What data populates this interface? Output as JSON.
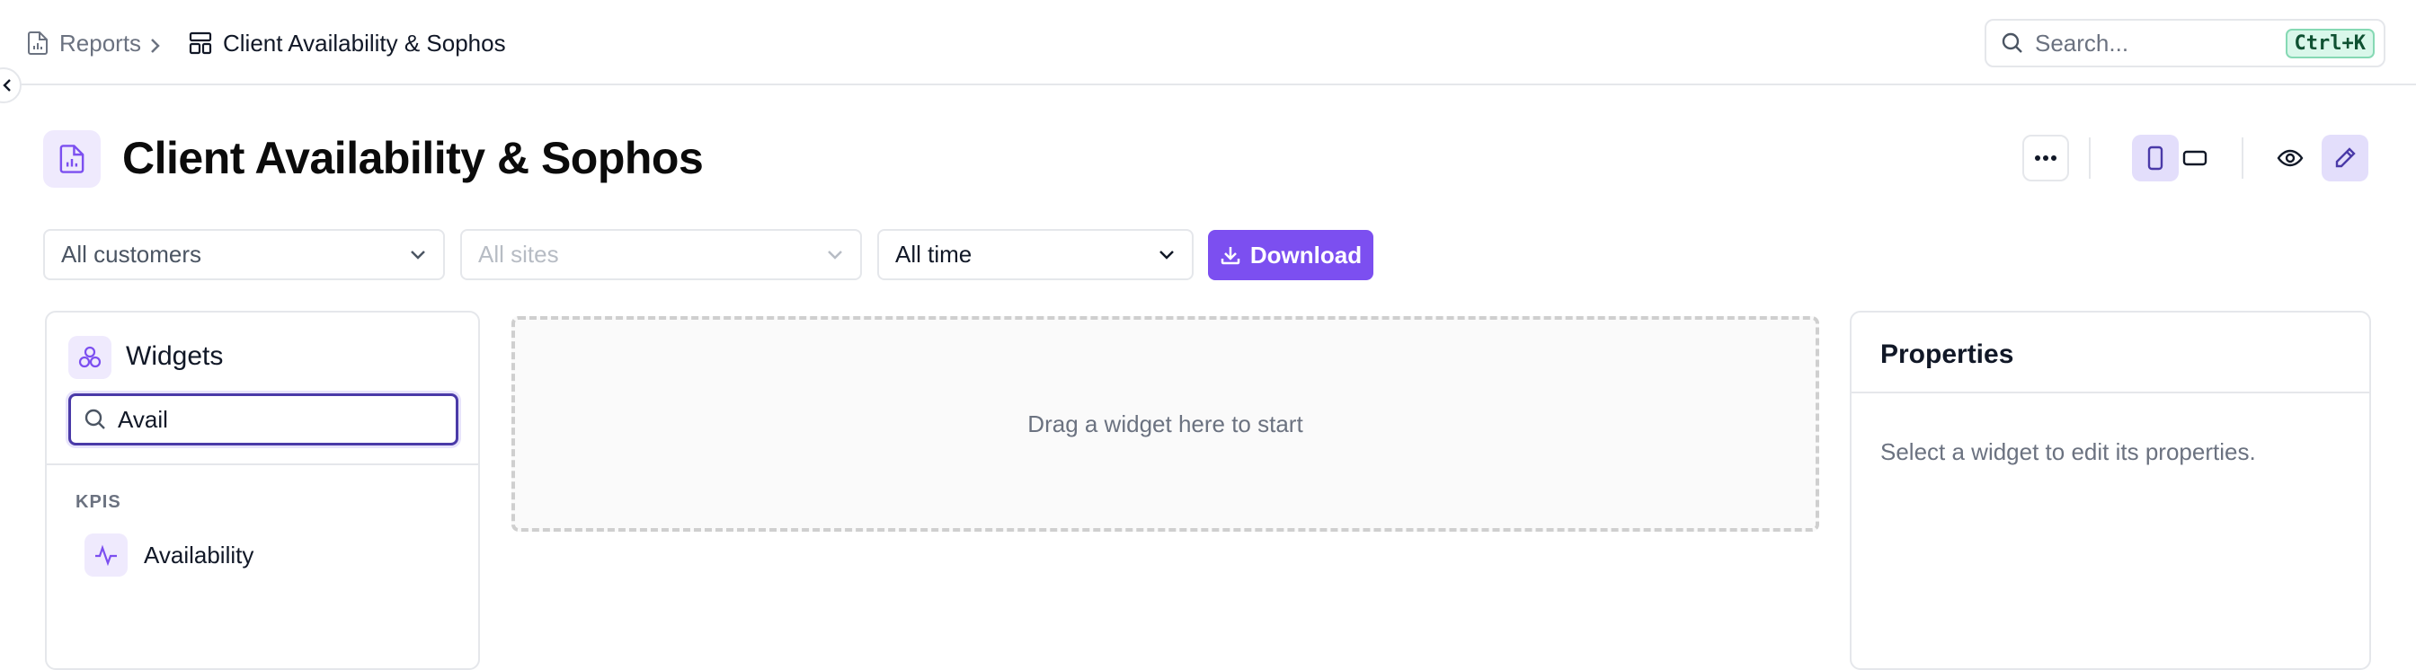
{
  "breadcrumb": {
    "parent": "Reports",
    "current": "Client Availability & Sophos"
  },
  "search": {
    "placeholder": "Search...",
    "shortcut": "Ctrl+K"
  },
  "page": {
    "title": "Client Availability & Sophos"
  },
  "filters": {
    "customers": "All customers",
    "sites": "All sites",
    "time": "All time",
    "download_label": "Download"
  },
  "widgets_panel": {
    "title": "Widgets",
    "search_value": "Avail",
    "section_label": "KPIS",
    "items": [
      {
        "label": "Availability",
        "icon": "activity-icon"
      }
    ]
  },
  "canvas": {
    "empty_text": "Drag a widget here to start"
  },
  "properties_panel": {
    "title": "Properties",
    "empty_text": "Select a widget to edit its properties."
  },
  "colors": {
    "accent": "#7c4ff0",
    "accent_soft": "#efeafd",
    "border": "#e5e7eb"
  }
}
